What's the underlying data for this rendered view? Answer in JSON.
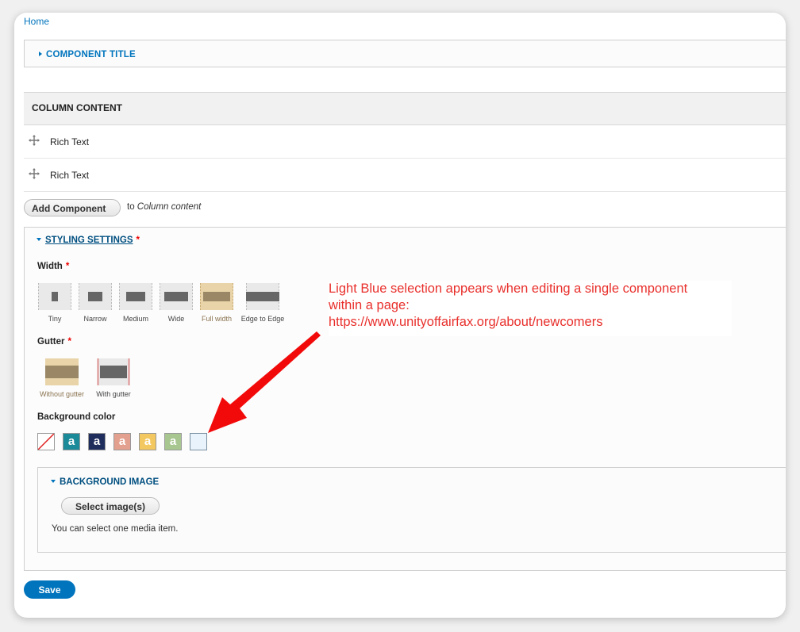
{
  "breadcrumb": {
    "home": "Home"
  },
  "component_title": {
    "label": "COMPONENT TITLE"
  },
  "column_content": {
    "header": "COLUMN CONTENT",
    "rows": [
      {
        "label": "Rich Text"
      },
      {
        "label": "Rich Text"
      }
    ]
  },
  "add_component": {
    "button": "Add Component",
    "suffix_to": "to",
    "suffix_target": "Column content"
  },
  "styling": {
    "summary": "STYLING SETTINGS",
    "required_mark": "*",
    "width": {
      "label": "Width",
      "options": [
        "Tiny",
        "Narrow",
        "Medium",
        "Wide",
        "Full width",
        "Edge to Edge"
      ],
      "selected": "Full width"
    },
    "gutter": {
      "label": "Gutter",
      "options": [
        "Without gutter",
        "With gutter"
      ],
      "selected": "Without gutter"
    },
    "background_color": {
      "label": "Background color",
      "letter": "a",
      "swatches": [
        {
          "name": "none",
          "color": "#ffffff"
        },
        {
          "name": "teal",
          "color": "#1b8a99"
        },
        {
          "name": "navy",
          "color": "#1f2d5c"
        },
        {
          "name": "salmon",
          "color": "#e3a08e"
        },
        {
          "name": "yellow",
          "color": "#f4c860"
        },
        {
          "name": "sage",
          "color": "#a8c690"
        },
        {
          "name": "light-blue",
          "color": "#e8f3fb"
        }
      ]
    },
    "background_image": {
      "summary": "BACKGROUND IMAGE",
      "button": "Select image(s)",
      "note": "You can select one media item."
    }
  },
  "save": {
    "label": "Save"
  },
  "annotation": {
    "line1": "Light Blue selection appears when editing a single component",
    "line2": "within a page:",
    "line3": "https://www.unityoffairfax.org/about/newcomers"
  },
  "colors": {
    "link": "#0074bd",
    "accent_tan": "#e8d4a8",
    "annotation_red": "#e8302c"
  }
}
